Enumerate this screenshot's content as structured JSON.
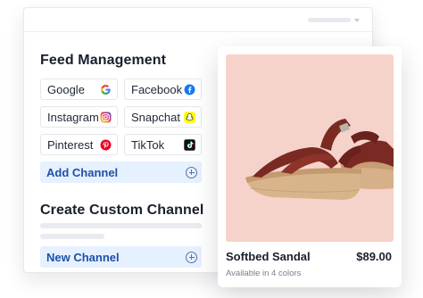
{
  "feed": {
    "title": "Feed Management",
    "channels": [
      {
        "label": "Google",
        "icon": "google-icon"
      },
      {
        "label": "Facebook",
        "icon": "facebook-icon"
      },
      {
        "label": "Instagram",
        "icon": "instagram-icon"
      },
      {
        "label": "Snapchat",
        "icon": "snapchat-icon"
      },
      {
        "label": "Pinterest",
        "icon": "pinterest-icon"
      },
      {
        "label": "TikTok",
        "icon": "tiktok-icon"
      }
    ],
    "add_label": "Add Channel"
  },
  "custom": {
    "title": "Create Custom Channel",
    "new_label": "New Channel"
  },
  "product": {
    "name": "Softbed Sandal",
    "price": "$89.00",
    "availability": "Available in 4 colors"
  },
  "colors": {
    "accent": "#1e4fa8",
    "accent_bg": "#e6f1ff",
    "photo_bg": "#f6d3ca",
    "strap": "#7a2a23",
    "sole": "#d8b48a"
  }
}
